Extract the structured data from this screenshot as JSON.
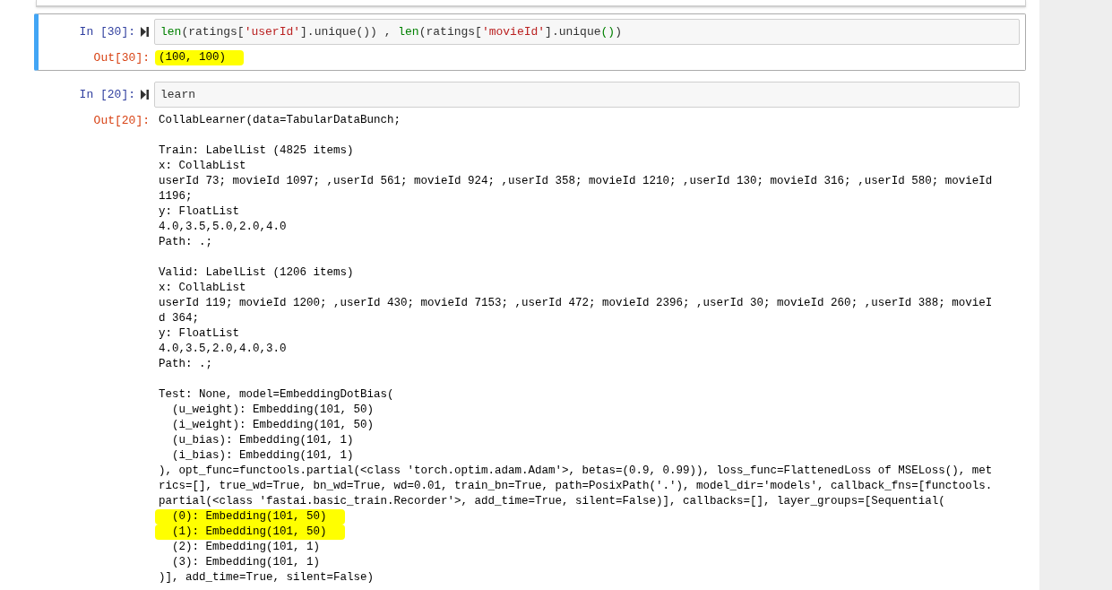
{
  "cells": [
    {
      "selected": true,
      "in_prompt": "In [30]:",
      "code": [
        {
          "kind": "builtin",
          "text": "len"
        },
        {
          "kind": "plain",
          "text": "(ratings["
        },
        {
          "kind": "string",
          "text": "'userId'"
        },
        {
          "kind": "plain",
          "text": "].unique()) , "
        },
        {
          "kind": "builtin",
          "text": "len"
        },
        {
          "kind": "plain",
          "text": "(ratings["
        },
        {
          "kind": "string",
          "text": "'movieId'"
        },
        {
          "kind": "plain",
          "text": "].unique"
        },
        {
          "kind": "bracket",
          "text": "()"
        },
        {
          "kind": "plain",
          "text": ")"
        }
      ],
      "out_prompt": "Out[30]:",
      "output": [
        {
          "lines": [
            {
              "text": "(100, 100)",
              "highlighted": true
            }
          ]
        }
      ]
    },
    {
      "selected": false,
      "in_prompt": "In [20]:",
      "code": [
        {
          "kind": "plain",
          "text": "learn"
        }
      ],
      "out_prompt": "Out[20]:",
      "output": [
        {
          "lines": [
            {
              "text": "CollabLearner(data=TabularDataBunch;",
              "highlighted": false
            }
          ]
        },
        {
          "lines": [
            {
              "text": "Train: LabelList (4825 items)",
              "highlighted": false
            },
            {
              "text": "x: CollabList",
              "highlighted": false
            },
            {
              "text": "userId 73; movieId 1097; ,userId 561; movieId 924; ,userId 358; movieId 1210; ,userId 130; movieId 316; ,userId 580; movieId",
              "highlighted": false
            },
            {
              "text": "1196;",
              "highlighted": false
            },
            {
              "text": "y: FloatList",
              "highlighted": false
            },
            {
              "text": "4.0,3.5,5.0,2.0,4.0",
              "highlighted": false
            },
            {
              "text": "Path: .;",
              "highlighted": false
            }
          ]
        },
        {
          "lines": [
            {
              "text": "Valid: LabelList (1206 items)",
              "highlighted": false
            },
            {
              "text": "x: CollabList",
              "highlighted": false
            },
            {
              "text": "userId 119; movieId 1200; ,userId 430; movieId 7153; ,userId 472; movieId 2396; ,userId 30; movieId 260; ,userId 388; movieI",
              "highlighted": false
            },
            {
              "text": "d 364;",
              "highlighted": false
            },
            {
              "text": "y: FloatList",
              "highlighted": false
            },
            {
              "text": "4.0,3.5,2.0,4.0,3.0",
              "highlighted": false
            },
            {
              "text": "Path: .;",
              "highlighted": false
            }
          ]
        },
        {
          "lines": [
            {
              "text": "Test: None, model=EmbeddingDotBias(",
              "highlighted": false
            },
            {
              "text": "  (u_weight): Embedding(101, 50)",
              "highlighted": false
            },
            {
              "text": "  (i_weight): Embedding(101, 50)",
              "highlighted": false
            },
            {
              "text": "  (u_bias): Embedding(101, 1)",
              "highlighted": false
            },
            {
              "text": "  (i_bias): Embedding(101, 1)",
              "highlighted": false
            },
            {
              "text": "), opt_func=functools.partial(<class 'torch.optim.adam.Adam'>, betas=(0.9, 0.99)), loss_func=FlattenedLoss of MSELoss(), met",
              "highlighted": false
            },
            {
              "text": "rics=[], true_wd=True, bn_wd=True, wd=0.01, train_bn=True, path=PosixPath('.'), model_dir='models', callback_fns=[functools.",
              "highlighted": false
            },
            {
              "text": "partial(<class 'fastai.basic_train.Recorder'>, add_time=True, silent=False)], callbacks=[], layer_groups=[Sequential(",
              "highlighted": false
            },
            {
              "text": "  (0): Embedding(101, 50)",
              "highlighted": true
            },
            {
              "text": "  (1): Embedding(101, 50)",
              "highlighted": true
            },
            {
              "text": "  (2): Embedding(101, 1)",
              "highlighted": false
            },
            {
              "text": "  (3): Embedding(101, 1)",
              "highlighted": false
            },
            {
              "text": ")], add_time=True, silent=False)",
              "highlighted": false
            }
          ]
        }
      ]
    }
  ]
}
